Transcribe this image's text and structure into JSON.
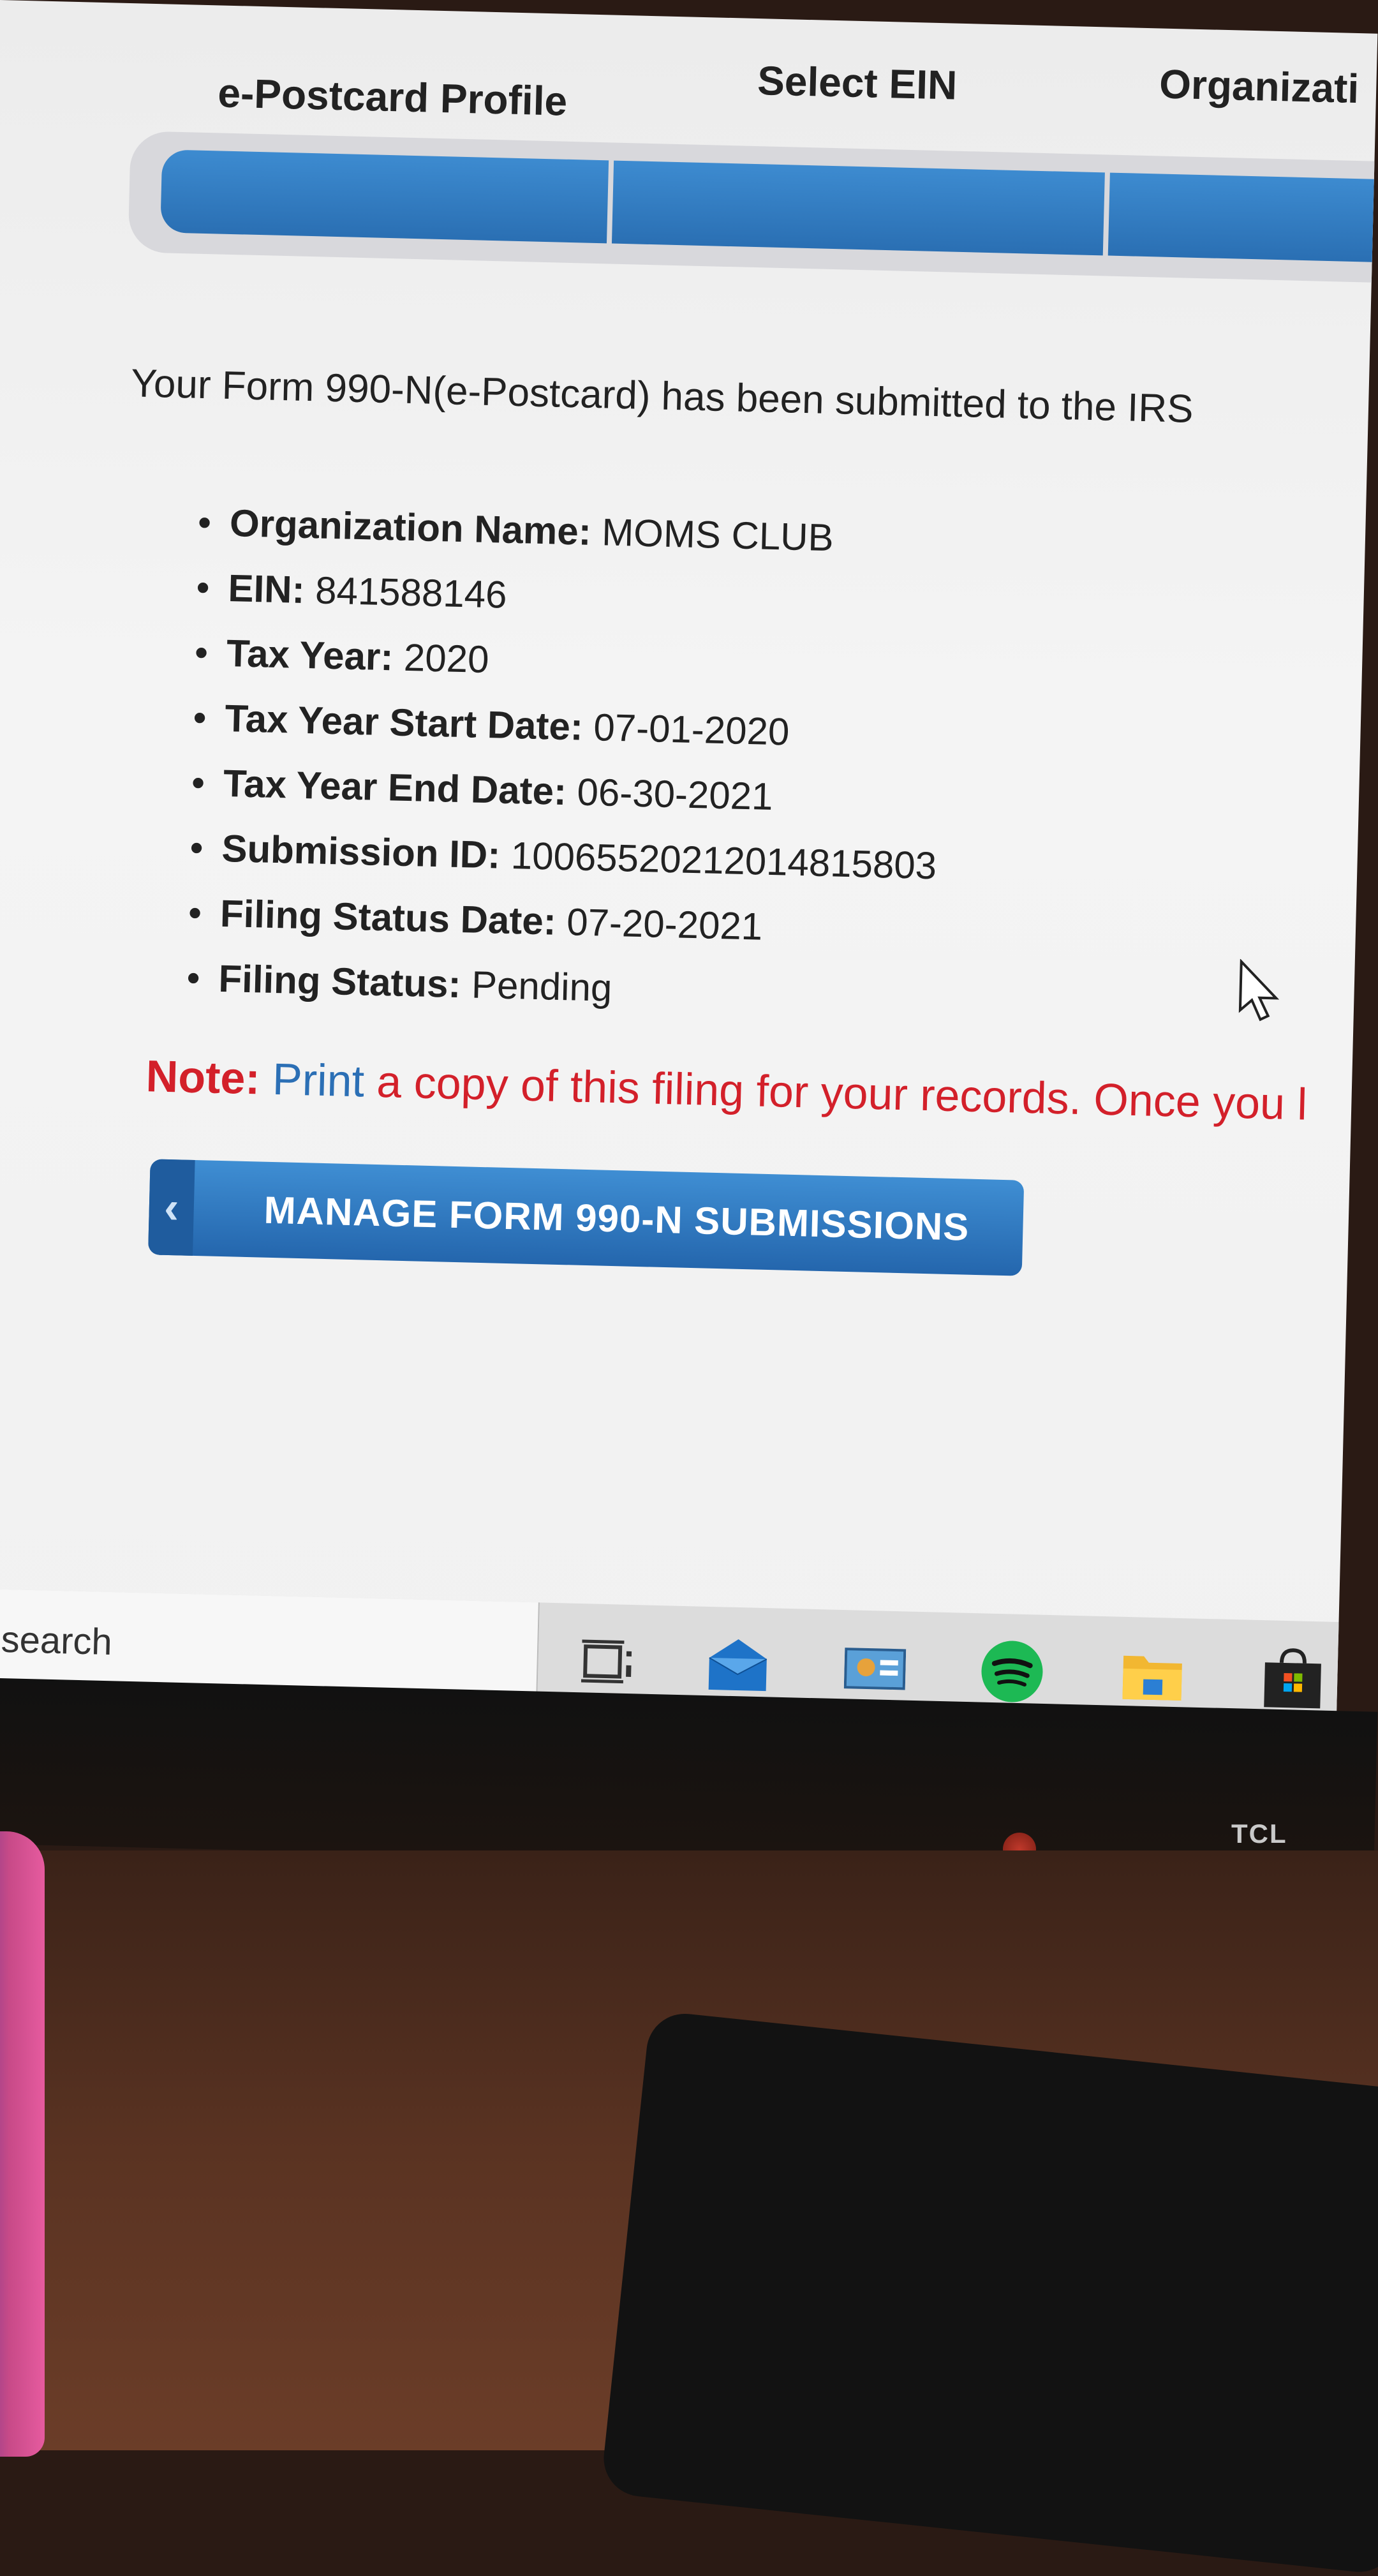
{
  "steps": [
    {
      "label": "e-Postcard Profile"
    },
    {
      "label": "Select EIN"
    },
    {
      "label": "Organizati"
    }
  ],
  "confirmation": {
    "message": "Your Form 990-N(e-Postcard) has been submitted to the IRS"
  },
  "details": [
    {
      "label": "Organization Name:",
      "value": "MOMS CLUB"
    },
    {
      "label": "EIN:",
      "value": "841588146"
    },
    {
      "label": "Tax Year:",
      "value": "2020"
    },
    {
      "label": "Tax Year Start Date:",
      "value": "07-01-2020"
    },
    {
      "label": "Tax Year End Date:",
      "value": "06-30-2021"
    },
    {
      "label": "Submission ID:",
      "value": "10065520212014815803"
    },
    {
      "label": "Filing Status Date:",
      "value": "07-20-2021"
    },
    {
      "label": "Filing Status:",
      "value": "Pending"
    }
  ],
  "note": {
    "label": "Note:",
    "print_word": "Print",
    "text": "a copy of this filing for your records. Once you l"
  },
  "manage_button": {
    "label": "MANAGE FORM 990-N SUBMISSIONS"
  },
  "taskbar": {
    "search_text": "to search",
    "icons": [
      "task-view-icon",
      "mail-icon",
      "control-panel-icon",
      "spotify-icon",
      "file-explorer-icon",
      "store-icon"
    ]
  },
  "monitor": {
    "brand": "TCL"
  },
  "colors": {
    "accent_blue": "#2a6fb3",
    "note_red": "#d3202a"
  }
}
